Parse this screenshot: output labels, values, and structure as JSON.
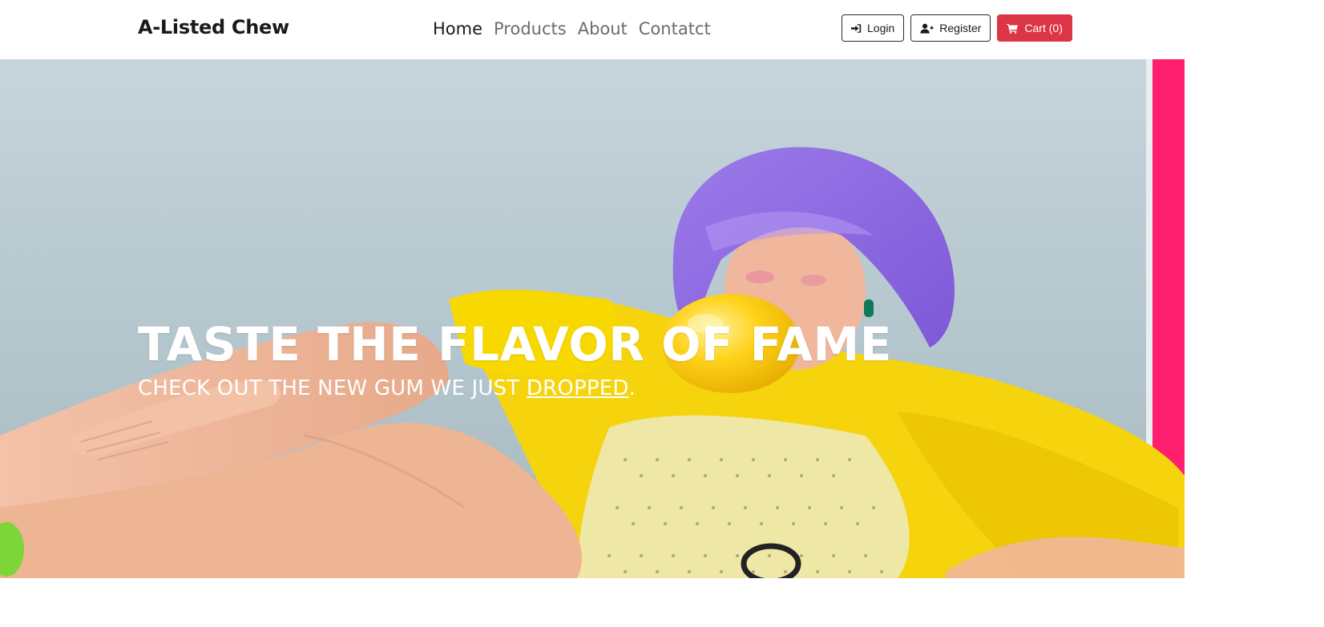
{
  "brand": {
    "name": "A-Listed Chew"
  },
  "nav": {
    "items": [
      {
        "label": "Home",
        "active": true
      },
      {
        "label": "Products",
        "active": false
      },
      {
        "label": "About",
        "active": false
      },
      {
        "label": "Contatct",
        "active": false
      }
    ]
  },
  "actions": {
    "login_label": "Login",
    "register_label": "Register",
    "cart_label": "Cart (0)"
  },
  "hero": {
    "title": "TASTE THE FLAVOR OF FAME",
    "subtitle_before": "CHECK OUT THE NEW GUM WE JUST ",
    "subtitle_link": "DROPPED",
    "subtitle_after": "."
  },
  "icons": {
    "login": "sign-in-icon",
    "register": "user-plus-icon",
    "cart": "shopping-cart-icon"
  },
  "colors": {
    "cart_button": "#dc3545",
    "brand_text": "#1a1a1a",
    "nav_muted": "#6c6c6c",
    "hero_text": "#ffffff"
  }
}
